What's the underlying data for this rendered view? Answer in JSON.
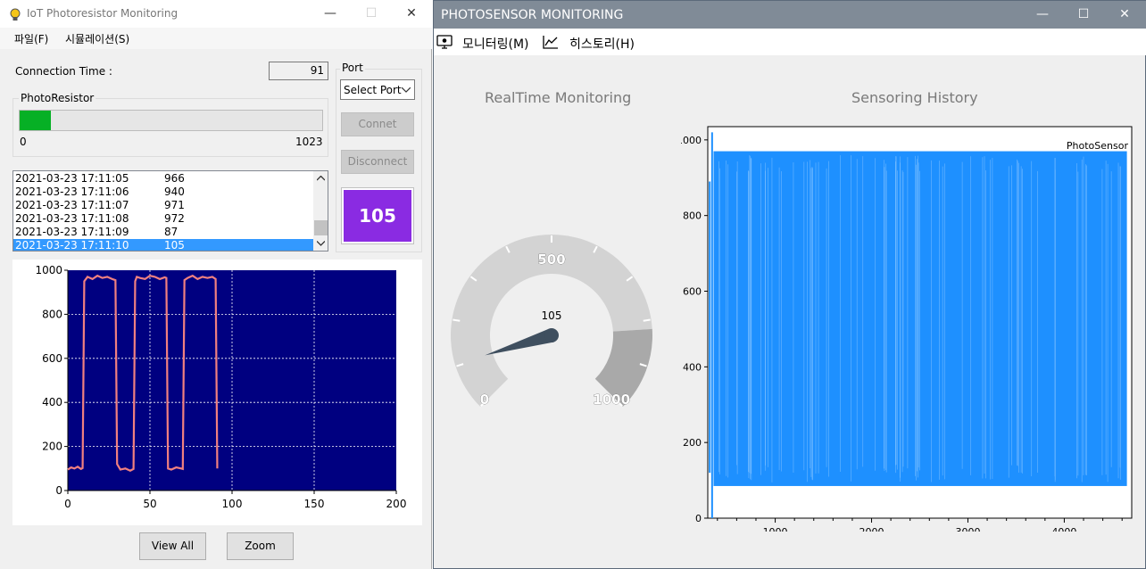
{
  "left_window": {
    "title": "IoT Photoresistor Monitoring",
    "menu": [
      "파일(F)",
      "시뮬레이션(S)"
    ],
    "connection_time_label": "Connection Time :",
    "connection_time_value": "91",
    "port_group_label": "Port",
    "port_select_value": "Select Port",
    "connect_button": "Connet",
    "disconnect_button": "Disconnect",
    "photoresistor_group_label": "PhotoResistor",
    "progress_min": "0",
    "progress_max": "1023",
    "progress_value": 105,
    "progress_color": "#06b025",
    "value_display": "105",
    "value_display_color": "#8a2be2",
    "log_rows": [
      {
        "timestamp": "2021-03-23 17:11:05",
        "value": "966"
      },
      {
        "timestamp": "2021-03-23 17:11:06",
        "value": "940"
      },
      {
        "timestamp": "2021-03-23 17:11:07",
        "value": "971"
      },
      {
        "timestamp": "2021-03-23 17:11:08",
        "value": "972"
      },
      {
        "timestamp": "2021-03-23 17:11:09",
        "value": "87"
      },
      {
        "timestamp": "2021-03-23 17:11:10",
        "value": "105"
      }
    ],
    "selected_row": 5,
    "view_all_button": "View All",
    "zoom_button": "Zoom"
  },
  "right_window": {
    "title": "PHOTOSENSOR MONITORING",
    "menu": [
      "모니터링(M)",
      "히스토리(H)"
    ],
    "realtime_title": "RealTime Monitoring",
    "history_title": "Sensoring History",
    "gauge": {
      "value": "105",
      "min_label": "0",
      "mid_label": "500",
      "max_label": "1000"
    }
  },
  "chart_data": [
    {
      "type": "line",
      "title": "",
      "xlim": [
        0,
        200
      ],
      "ylim": [
        0,
        1000
      ],
      "x_ticks": [
        "0",
        "50",
        "100",
        "150",
        "200"
      ],
      "y_ticks": [
        "0",
        "200",
        "400",
        "600",
        "800",
        "1000"
      ],
      "background": "#000080",
      "line_color": "#f08080",
      "series": [
        {
          "x": [
            0,
            2,
            4,
            6,
            8,
            9,
            10,
            12,
            15,
            18,
            21,
            24,
            27,
            29,
            30,
            32,
            35,
            38,
            40,
            41,
            42,
            44,
            47,
            50,
            53,
            56,
            59,
            60,
            61,
            63,
            66,
            69,
            70,
            71,
            73,
            76,
            79,
            82,
            85,
            88,
            90,
            91
          ],
          "values": [
            95,
            105,
            100,
            108,
            98,
            102,
            950,
            970,
            960,
            975,
            965,
            970,
            960,
            955,
            120,
            95,
            100,
            90,
            98,
            950,
            970,
            965,
            960,
            975,
            970,
            960,
            968,
            965,
            100,
            95,
            105,
            100,
            98,
            955,
            965,
            975,
            960,
            970,
            965,
            970,
            960,
            100
          ]
        }
      ]
    },
    {
      "type": "line",
      "title": "",
      "xlim": [
        300,
        4700
      ],
      "ylim": [
        0,
        1000
      ],
      "x_ticks": [
        "1000",
        "2000",
        "3000",
        "4000"
      ],
      "y_ticks": [
        "0",
        "200",
        "400",
        "600",
        "800",
        "1000"
      ],
      "line_color": "#1e90ff",
      "series": [
        {
          "name": "PhotoSensor",
          "summary_high": 970,
          "summary_low": 85,
          "spike": 1020,
          "dip": 0
        }
      ]
    }
  ]
}
